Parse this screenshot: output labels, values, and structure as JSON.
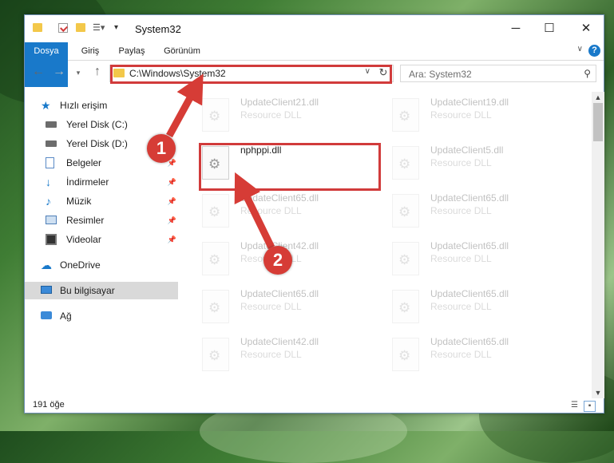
{
  "window": {
    "title": "System32"
  },
  "ribbon": {
    "tabs": [
      "Dosya",
      "Giriş",
      "Paylaş",
      "Görünüm"
    ],
    "help": "?"
  },
  "address": {
    "path": "C:\\Windows\\System32",
    "search_placeholder": "Ara: System32"
  },
  "nav": {
    "quick_access": "Hızlı erişim",
    "items": [
      {
        "label": "Yerel Disk (C:)",
        "icon": "drive-icon",
        "pinned": false
      },
      {
        "label": "Yerel Disk (D:)",
        "icon": "drive-icon",
        "pinned": false
      },
      {
        "label": "Belgeler",
        "icon": "documents-icon",
        "pinned": true
      },
      {
        "label": "İndirmeler",
        "icon": "downloads-icon",
        "pinned": true
      },
      {
        "label": "Müzik",
        "icon": "music-icon",
        "pinned": true
      },
      {
        "label": "Resimler",
        "icon": "pictures-icon",
        "pinned": true
      },
      {
        "label": "Videolar",
        "icon": "videos-icon",
        "pinned": true
      }
    ],
    "onedrive": "OneDrive",
    "this_pc": "Bu bilgisayar",
    "network": "Ağ"
  },
  "files": {
    "left": [
      {
        "name": "UpdateClient21.dll",
        "type": "Resource DLL",
        "faded": true
      },
      {
        "name": "nphppi.dll",
        "type": "",
        "faded": false
      },
      {
        "name": "UpdateClient65.dll",
        "type": "Resource DLL",
        "faded": true
      },
      {
        "name": "UpdateClient42.dll",
        "type": "Resource DLL",
        "faded": true
      },
      {
        "name": "UpdateClient65.dll",
        "type": "Resource DLL",
        "faded": true
      },
      {
        "name": "UpdateClient42.dll",
        "type": "Resource DLL",
        "faded": true
      }
    ],
    "right": [
      {
        "name": "UpdateClient19.dll",
        "type": "Resource DLL",
        "faded": true
      },
      {
        "name": "UpdateClient5.dll",
        "type": "Resource DLL",
        "faded": true
      },
      {
        "name": "UpdateClient65.dll",
        "type": "Resource DLL",
        "faded": true
      },
      {
        "name": "UpdateClient65.dll",
        "type": "Resource DLL",
        "faded": true
      },
      {
        "name": "UpdateClient65.dll",
        "type": "Resource DLL",
        "faded": true
      },
      {
        "name": "UpdateClient65.dll",
        "type": "Resource DLL",
        "faded": true
      }
    ]
  },
  "status": {
    "count": "191 öğe"
  },
  "annotations": {
    "badge1": "1",
    "badge2": "2",
    "color": "#d63c36"
  }
}
